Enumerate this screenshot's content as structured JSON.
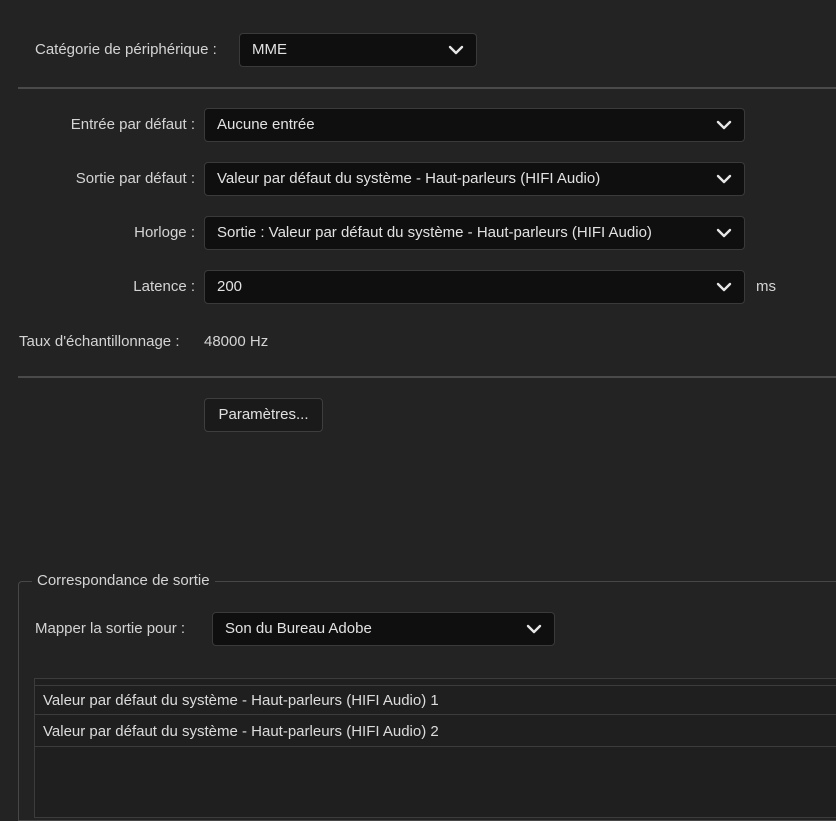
{
  "device": {
    "category_label": "Catégorie de périphérique :",
    "category_value": "MME"
  },
  "settings": {
    "input_label": "Entrée par défaut :",
    "input_value": "Aucune entrée",
    "output_label": "Sortie par défaut :",
    "output_value": "Valeur par défaut du système - Haut-parleurs (HIFI Audio)",
    "clock_label": "Horloge :",
    "clock_value": "Sortie : Valeur par défaut du système - Haut-parleurs (HIFI Audio)",
    "latency_label": "Latence :",
    "latency_value": "200",
    "latency_unit": "ms",
    "sample_rate_label": "Taux d'échantillonnage :",
    "sample_rate_value": "48000 Hz",
    "params_button": "Paramètres..."
  },
  "mapping": {
    "group_title": "Correspondance de sortie",
    "map_label": "Mapper la sortie pour :",
    "map_value": "Son du Bureau Adobe",
    "channels": [
      "Valeur par défaut du système - Haut-parleurs (HIFI Audio) 1",
      "Valeur par défaut du système - Haut-parleurs (HIFI Audio) 2"
    ]
  },
  "icons": {
    "dropdown": "chevron-down-icon"
  },
  "colors": {
    "background": "#232323",
    "field_bg": "#0f0f0f",
    "text": "#d6d6d6"
  }
}
